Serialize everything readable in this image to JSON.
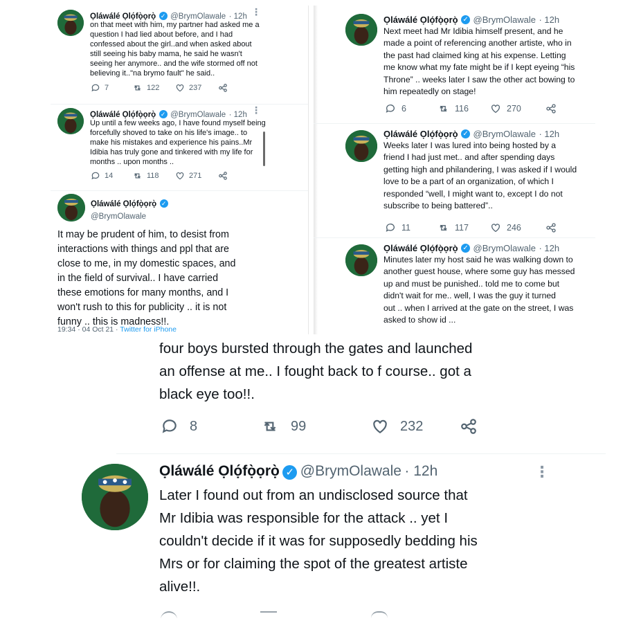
{
  "author": {
    "name": "Ọláwálé Ọlọ́fọ̀ọrọ̀",
    "handle": "@BrymOlawale",
    "verified_icon": "verified-badge-icon",
    "colors": {
      "badge": "#1d9bf0",
      "avatar_bg": "#1f6a3a"
    }
  },
  "panel1": {
    "tweet1": {
      "time": "· 12h",
      "text": "on that meet with him, my partner had asked me a\nquestion I had lied about before, and I had\nconfessed about the girl..and when asked about\nstill seeing his baby mama, he said he wasn't\nseeing her anymore.. and the wife stormed off not\nbelieving it..\"na brymo fault\" he said..",
      "replies": "7",
      "retweets": "122",
      "likes": "237"
    },
    "tweet2": {
      "time": "· 12h",
      "text": "Up until a few weeks ago, I have found myself being\nforcefully shoved to take on his life's image.. to\nmake his mistakes and experience his pains..Mr\nIdibia has truly gone and tinkered with my life for\nmonths .. upon months ..",
      "replies": "14",
      "retweets": "118",
      "likes": "271"
    },
    "tweet3": {
      "text": "It may be prudent of him, to desist from\ninteractions with things and ppl that are\nclose to me, in my domestic spaces, and\nin the field of survival.. I have carried\nthese emotions for many months, and I\nwon't rush to this for publicity .. it is not\nfunny .. this is madness!!.",
      "timestamp": "19:34 · 04 Oct 21 · ",
      "source": "Twitter for iPhone"
    }
  },
  "panel2": {
    "tweet1": {
      "time": "· 12h",
      "text": "Next meet had Mr Idibia himself present, and he\nmade a point of referencing another artiste, who in\nthe past had claimed king at his expense. Letting\nme know what my fate might be if I kept eyeing “his\nThrone” .. weeks later I saw the other act bowing to\nhim repeatedly on stage!",
      "replies": "6",
      "retweets": "116",
      "likes": "270"
    },
    "tweet2": {
      "time": "· 12h",
      "text": "Weeks later I was lured into being hosted by a\nfriend I had just met.. and after spending days\ngetting high and philandering, I was asked if I would\nlove to be a part of an organization, of which I\nresponded “well, I might want to, except I do not\nsubscribe to being battered”..",
      "replies": "11",
      "retweets": "117",
      "likes": "246"
    },
    "tweet3": {
      "time": "· 12h",
      "text": "Minutes later my host said he was walking down to\nanother guest house, where some guy has messed\nup and must be punished.. told me to come but\ndidn't wait for me.. well, I was the guy it turned\nout .. when I arrived at the gate on the street, I was\nasked to show id ..."
    }
  },
  "panel3": {
    "tweet1": {
      "text": "four boys bursted through the gates and launched\nan offense at me.. I fought back to f course.. got a\nblack eye too!!.",
      "replies": "8",
      "retweets": "99",
      "likes": "232"
    },
    "tweet2": {
      "time": "· 12h",
      "text": "Later I found out from an undisclosed source that\nMr Idibia was responsible for the attack .. yet I\ncouldn't decide if it was for supposedly bedding his\nMrs or for claiming the spot of the greatest artiste\nalive!!."
    }
  }
}
